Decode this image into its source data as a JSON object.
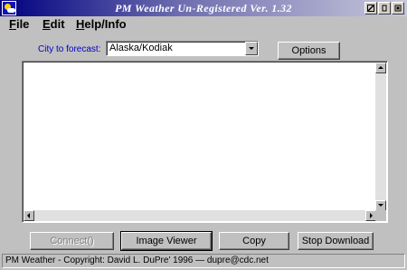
{
  "window": {
    "title": "PM Weather Un-Registered Ver. 1.32"
  },
  "menu": {
    "items": [
      {
        "label": "File",
        "accel": "F",
        "rest": "ile"
      },
      {
        "label": "Edit",
        "accel": "E",
        "rest": "dit"
      },
      {
        "label": "Help/Info",
        "accel": "H",
        "rest": "elp/Info"
      }
    ]
  },
  "forecast": {
    "city_label": "City to forecast:",
    "city_value": "Alaska/Kodiak",
    "options_label": "Options"
  },
  "output": {
    "text": ""
  },
  "buttons": {
    "connect_label": "Connect()",
    "image_viewer_label": "Image Viewer",
    "copy_label": "Copy",
    "stop_download_label": "Stop Download"
  },
  "status": {
    "text": "PM Weather - Copyright:  David L. DuPre' 1996 — dupre@cdc.net"
  },
  "icons": {
    "app": "weather-icon",
    "minimize": "minimize-icon",
    "maximize": "maximize-icon",
    "close": "close-icon"
  }
}
